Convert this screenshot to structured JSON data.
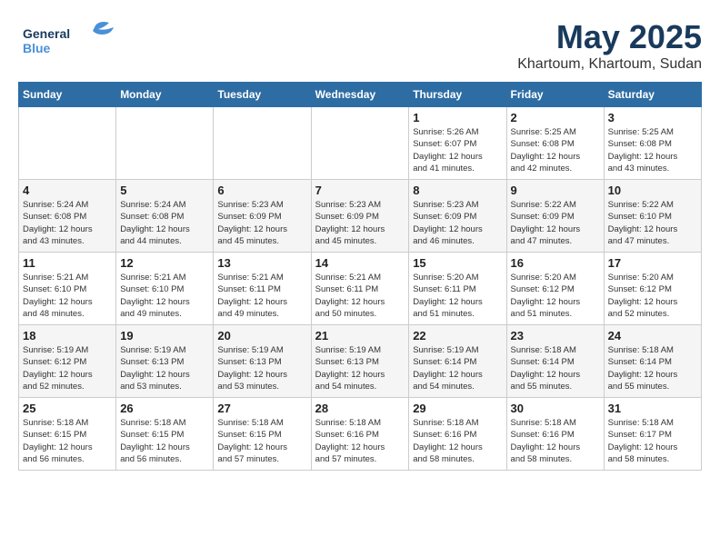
{
  "header": {
    "logo_line1": "General",
    "logo_line2": "Blue",
    "month": "May 2025",
    "location": "Khartoum, Khartoum, Sudan"
  },
  "days_of_week": [
    "Sunday",
    "Monday",
    "Tuesday",
    "Wednesday",
    "Thursday",
    "Friday",
    "Saturday"
  ],
  "weeks": [
    [
      {
        "day": "",
        "info": ""
      },
      {
        "day": "",
        "info": ""
      },
      {
        "day": "",
        "info": ""
      },
      {
        "day": "",
        "info": ""
      },
      {
        "day": "1",
        "info": "Sunrise: 5:26 AM\nSunset: 6:07 PM\nDaylight: 12 hours\nand 41 minutes."
      },
      {
        "day": "2",
        "info": "Sunrise: 5:25 AM\nSunset: 6:08 PM\nDaylight: 12 hours\nand 42 minutes."
      },
      {
        "day": "3",
        "info": "Sunrise: 5:25 AM\nSunset: 6:08 PM\nDaylight: 12 hours\nand 43 minutes."
      }
    ],
    [
      {
        "day": "4",
        "info": "Sunrise: 5:24 AM\nSunset: 6:08 PM\nDaylight: 12 hours\nand 43 minutes."
      },
      {
        "day": "5",
        "info": "Sunrise: 5:24 AM\nSunset: 6:08 PM\nDaylight: 12 hours\nand 44 minutes."
      },
      {
        "day": "6",
        "info": "Sunrise: 5:23 AM\nSunset: 6:09 PM\nDaylight: 12 hours\nand 45 minutes."
      },
      {
        "day": "7",
        "info": "Sunrise: 5:23 AM\nSunset: 6:09 PM\nDaylight: 12 hours\nand 45 minutes."
      },
      {
        "day": "8",
        "info": "Sunrise: 5:23 AM\nSunset: 6:09 PM\nDaylight: 12 hours\nand 46 minutes."
      },
      {
        "day": "9",
        "info": "Sunrise: 5:22 AM\nSunset: 6:09 PM\nDaylight: 12 hours\nand 47 minutes."
      },
      {
        "day": "10",
        "info": "Sunrise: 5:22 AM\nSunset: 6:10 PM\nDaylight: 12 hours\nand 47 minutes."
      }
    ],
    [
      {
        "day": "11",
        "info": "Sunrise: 5:21 AM\nSunset: 6:10 PM\nDaylight: 12 hours\nand 48 minutes."
      },
      {
        "day": "12",
        "info": "Sunrise: 5:21 AM\nSunset: 6:10 PM\nDaylight: 12 hours\nand 49 minutes."
      },
      {
        "day": "13",
        "info": "Sunrise: 5:21 AM\nSunset: 6:11 PM\nDaylight: 12 hours\nand 49 minutes."
      },
      {
        "day": "14",
        "info": "Sunrise: 5:21 AM\nSunset: 6:11 PM\nDaylight: 12 hours\nand 50 minutes."
      },
      {
        "day": "15",
        "info": "Sunrise: 5:20 AM\nSunset: 6:11 PM\nDaylight: 12 hours\nand 51 minutes."
      },
      {
        "day": "16",
        "info": "Sunrise: 5:20 AM\nSunset: 6:12 PM\nDaylight: 12 hours\nand 51 minutes."
      },
      {
        "day": "17",
        "info": "Sunrise: 5:20 AM\nSunset: 6:12 PM\nDaylight: 12 hours\nand 52 minutes."
      }
    ],
    [
      {
        "day": "18",
        "info": "Sunrise: 5:19 AM\nSunset: 6:12 PM\nDaylight: 12 hours\nand 52 minutes."
      },
      {
        "day": "19",
        "info": "Sunrise: 5:19 AM\nSunset: 6:13 PM\nDaylight: 12 hours\nand 53 minutes."
      },
      {
        "day": "20",
        "info": "Sunrise: 5:19 AM\nSunset: 6:13 PM\nDaylight: 12 hours\nand 53 minutes."
      },
      {
        "day": "21",
        "info": "Sunrise: 5:19 AM\nSunset: 6:13 PM\nDaylight: 12 hours\nand 54 minutes."
      },
      {
        "day": "22",
        "info": "Sunrise: 5:19 AM\nSunset: 6:14 PM\nDaylight: 12 hours\nand 54 minutes."
      },
      {
        "day": "23",
        "info": "Sunrise: 5:18 AM\nSunset: 6:14 PM\nDaylight: 12 hours\nand 55 minutes."
      },
      {
        "day": "24",
        "info": "Sunrise: 5:18 AM\nSunset: 6:14 PM\nDaylight: 12 hours\nand 55 minutes."
      }
    ],
    [
      {
        "day": "25",
        "info": "Sunrise: 5:18 AM\nSunset: 6:15 PM\nDaylight: 12 hours\nand 56 minutes."
      },
      {
        "day": "26",
        "info": "Sunrise: 5:18 AM\nSunset: 6:15 PM\nDaylight: 12 hours\nand 56 minutes."
      },
      {
        "day": "27",
        "info": "Sunrise: 5:18 AM\nSunset: 6:15 PM\nDaylight: 12 hours\nand 57 minutes."
      },
      {
        "day": "28",
        "info": "Sunrise: 5:18 AM\nSunset: 6:16 PM\nDaylight: 12 hours\nand 57 minutes."
      },
      {
        "day": "29",
        "info": "Sunrise: 5:18 AM\nSunset: 6:16 PM\nDaylight: 12 hours\nand 58 minutes."
      },
      {
        "day": "30",
        "info": "Sunrise: 5:18 AM\nSunset: 6:16 PM\nDaylight: 12 hours\nand 58 minutes."
      },
      {
        "day": "31",
        "info": "Sunrise: 5:18 AM\nSunset: 6:17 PM\nDaylight: 12 hours\nand 58 minutes."
      }
    ]
  ]
}
